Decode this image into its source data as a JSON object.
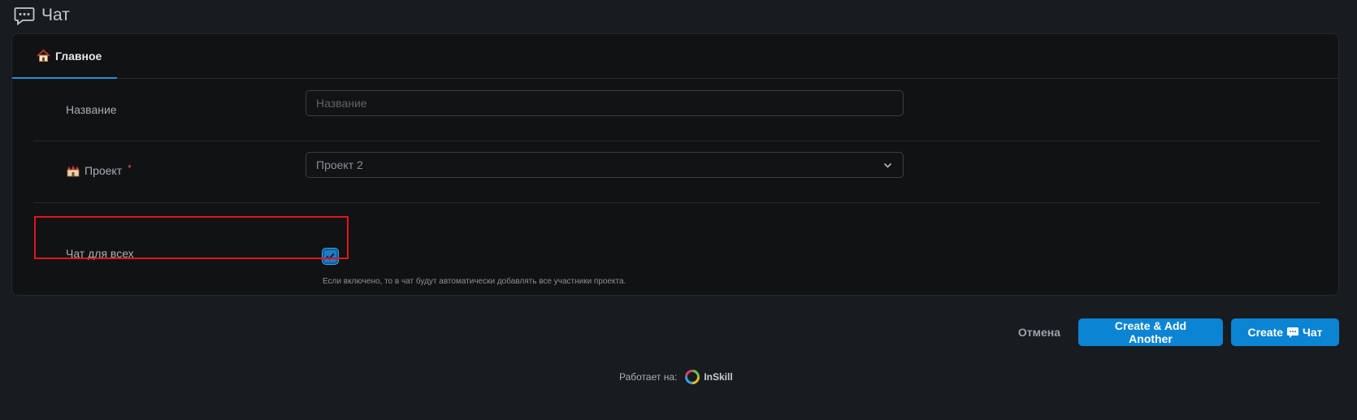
{
  "page": {
    "title": "Чат",
    "title_icon": "chat-bubble-icon"
  },
  "tabs": [
    {
      "label": "Главное",
      "icon": "house-icon",
      "active": true
    }
  ],
  "form": {
    "name": {
      "label": "Название",
      "placeholder": "Название",
      "value": ""
    },
    "project": {
      "label": "Проект",
      "icon": "castle-icon",
      "required": true,
      "required_mark": "*",
      "value": "Проект 2"
    },
    "chat_for_all": {
      "label": "Чат для всех",
      "checked": true,
      "help": "Если включено, то в чат будут автоматически добавлять все участники проекта."
    }
  },
  "actions": {
    "cancel_label": "Отмена",
    "create_another_label": "Create & Add Another",
    "create_label_prefix": "Create",
    "create_label_suffix": "Чат"
  },
  "footer": {
    "powered_by": "Работает на:",
    "brand": "InSkill"
  },
  "colors": {
    "accent": "#0b84d4",
    "highlight": "#e3141c",
    "background": "#181b1f",
    "card": "#111214"
  }
}
